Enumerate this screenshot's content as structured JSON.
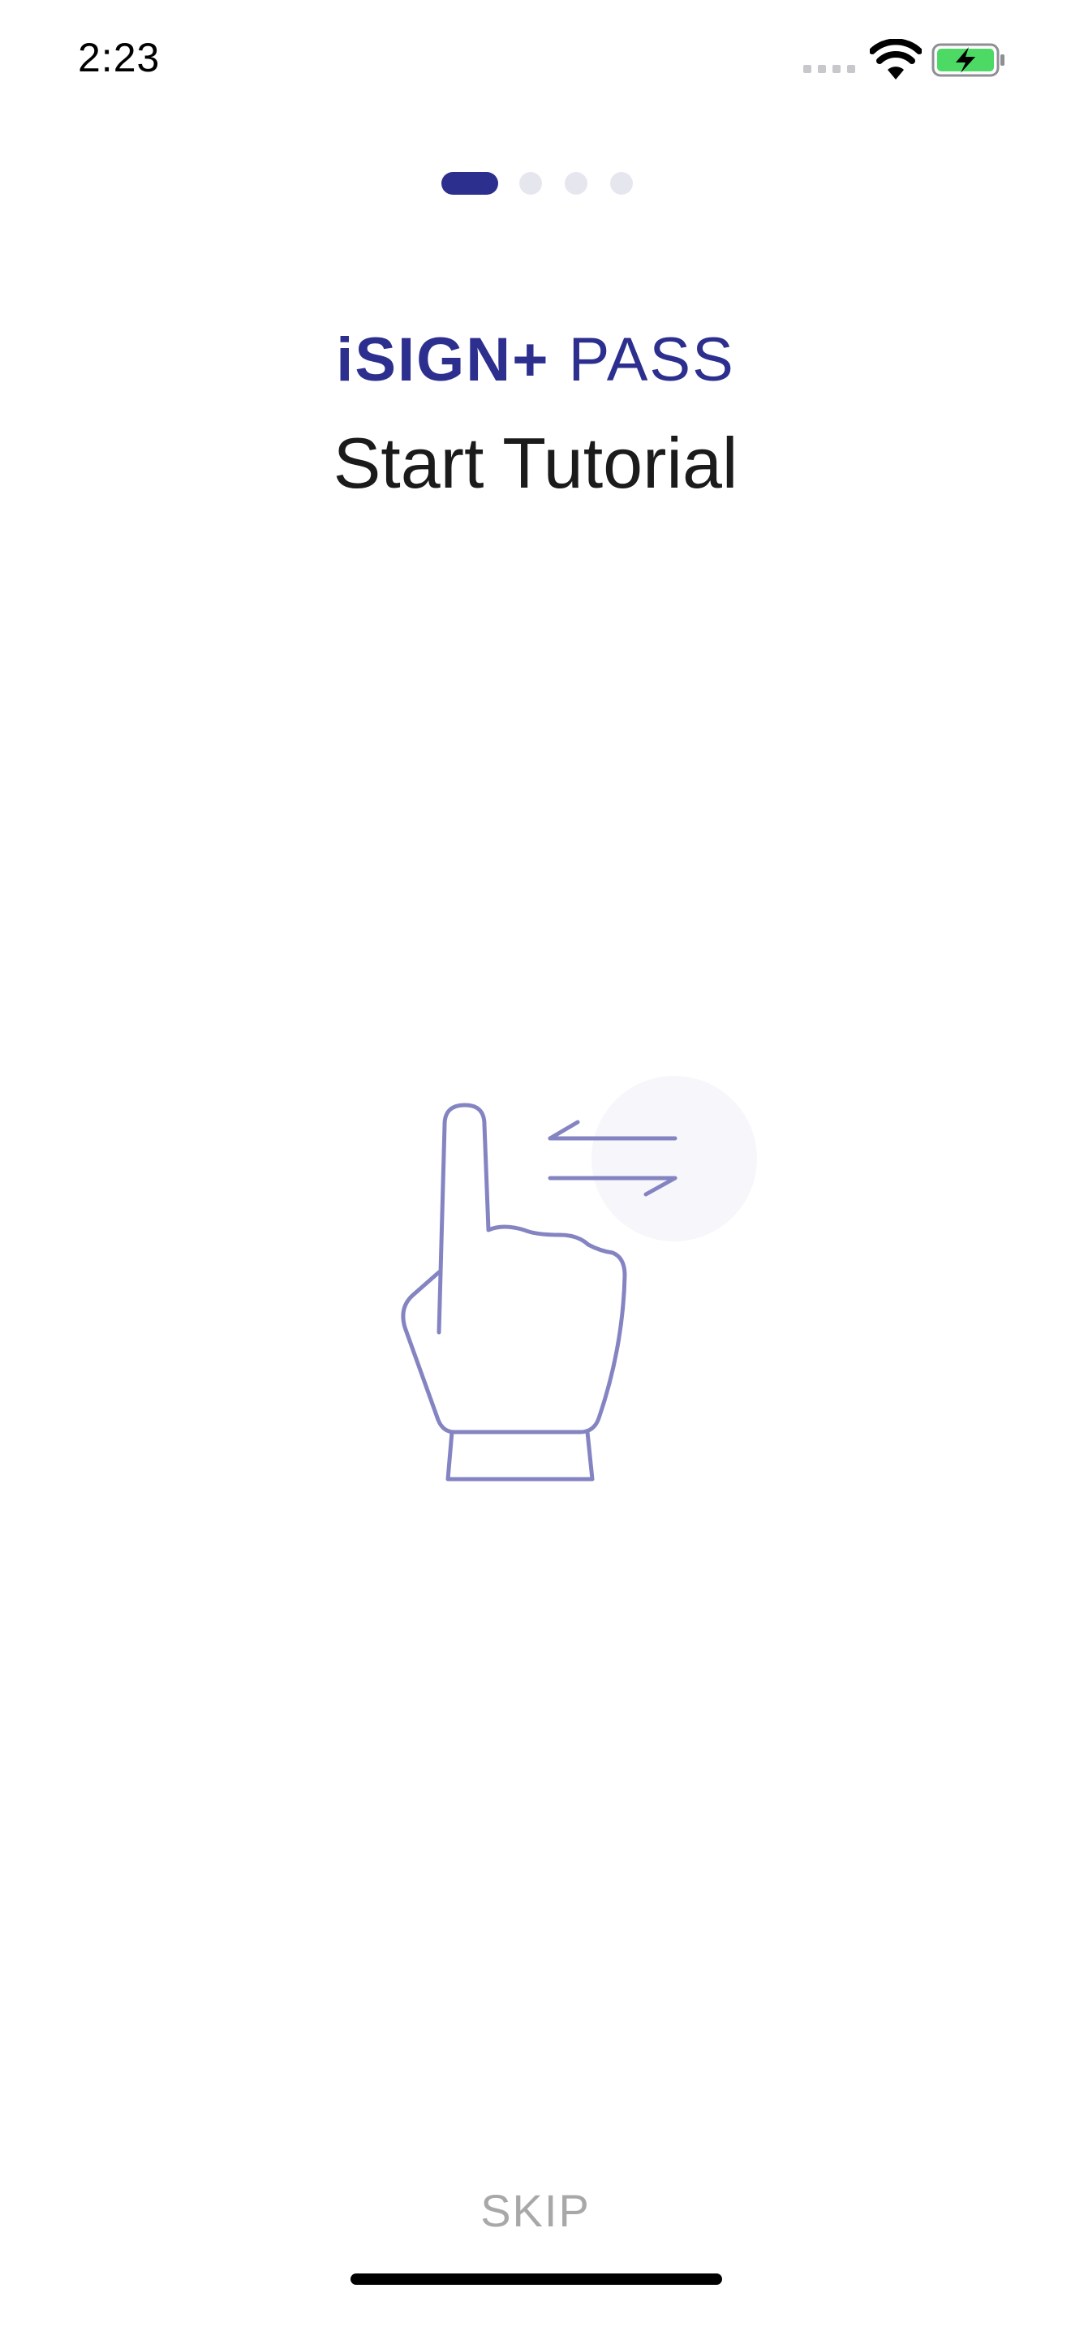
{
  "status_bar": {
    "time": "2:23",
    "battery_color": "#4cd964"
  },
  "pager": {
    "total": 4,
    "current": 1,
    "active_color": "#2d2f8f",
    "inactive_color": "#e6e6ef"
  },
  "brand": {
    "bold": "iSIGN+",
    "light": "PASS"
  },
  "title": "Start Tutorial",
  "illustration": {
    "icon": "swipe-gesture-icon",
    "color": "#8584c2"
  },
  "skip_label": "SKIP"
}
